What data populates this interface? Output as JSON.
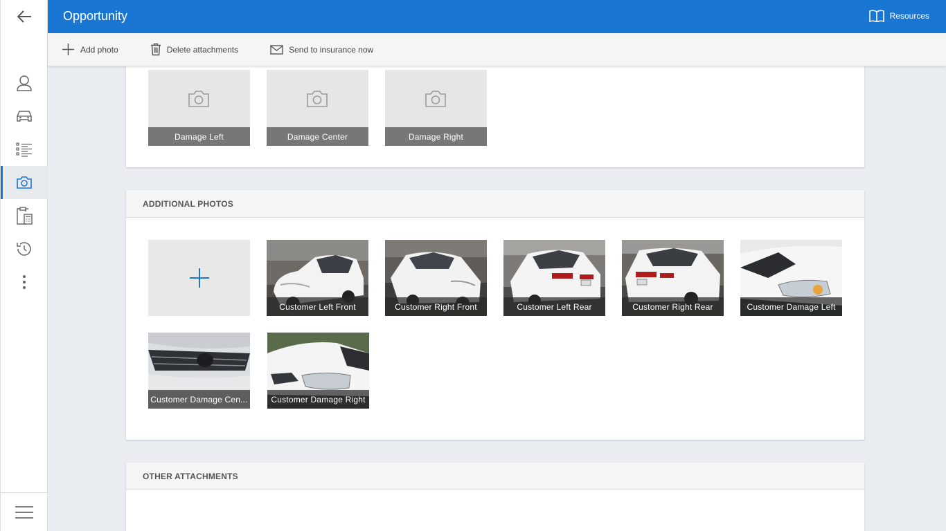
{
  "header": {
    "title": "Opportunity",
    "resources_label": "Resources"
  },
  "toolbar": {
    "add_photo": "Add photo",
    "delete_attachments": "Delete attachments",
    "send_to_insurance": "Send to insurance now"
  },
  "required_photos": [
    {
      "label": "Damage Left"
    },
    {
      "label": "Damage Center"
    },
    {
      "label": "Damage Right"
    }
  ],
  "additional_photos": {
    "heading": "ADDITIONAL PHOTOS",
    "items": [
      {
        "label": "Customer Left Front"
      },
      {
        "label": "Customer Right Front"
      },
      {
        "label": "Customer Left Rear"
      },
      {
        "label": "Customer Right Rear"
      },
      {
        "label": "Customer Damage Left"
      },
      {
        "label": "Customer Damage Cen..."
      },
      {
        "label": "Customer Damage Right"
      }
    ]
  },
  "other_attachments": {
    "heading": "OTHER ATTACHMENTS"
  },
  "colors": {
    "primary": "#1976d2",
    "rail_active": "#e8ebee"
  }
}
